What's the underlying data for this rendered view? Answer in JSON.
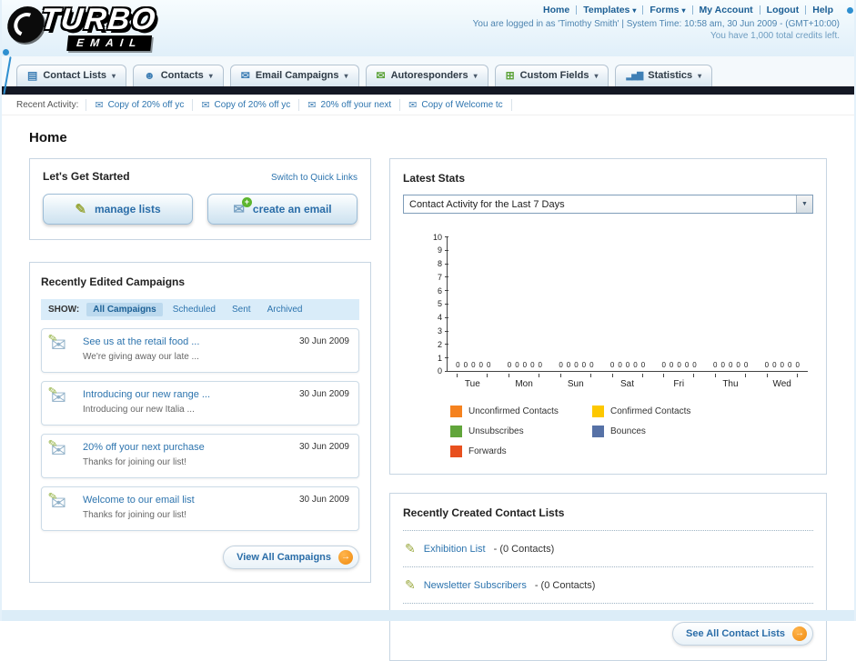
{
  "icons": {
    "chevron_down": "▾",
    "envelope": "✉",
    "pencil": "✎",
    "arrow_right": "→",
    "plus": "+",
    "select_arrow": "▼",
    "contact_lists": "▤",
    "contacts": "☻",
    "custom_fields": "⊞",
    "statistics": "▂▅▇"
  },
  "colors": {
    "accent_orange": "#f6921e",
    "link_blue": "#2d74ae",
    "nav_dark_bar": "#141824",
    "header_blue": "#e0eff9"
  },
  "header": {
    "logo_line1": "TURBO",
    "logo_line2": "EMAIL",
    "links": [
      {
        "label": "Home"
      },
      {
        "label": "Templates"
      },
      {
        "label": "Forms"
      },
      {
        "label": "My Account"
      },
      {
        "label": "Logout"
      },
      {
        "label": "Help"
      }
    ],
    "session_info": "You are logged in as 'Timothy Smith' | System Time: 10:58 am, 30 Jun 2009 - (GMT+10:00)",
    "credits_info": "You have 1,000 total credits left."
  },
  "nav_tabs": [
    {
      "label": "Contact Lists"
    },
    {
      "label": "Contacts"
    },
    {
      "label": "Email Campaigns"
    },
    {
      "label": "Autoresponders"
    },
    {
      "label": "Custom Fields"
    },
    {
      "label": "Statistics"
    }
  ],
  "recent_activity": {
    "label": "Recent Activity:",
    "items": [
      {
        "label": "Copy of 20% off yc"
      },
      {
        "label": "Copy of 20% off yc"
      },
      {
        "label": "20% off your next"
      },
      {
        "label": "Copy of Welcome tc"
      }
    ]
  },
  "page_title": "Home",
  "get_started": {
    "title": "Let's Get Started",
    "switch_link": "Switch to Quick Links",
    "manage_lists_label": "manage lists",
    "create_email_label": "create an email"
  },
  "campaigns": {
    "title": "Recently Edited Campaigns",
    "show_label": "SHOW:",
    "tabs": [
      {
        "label": "All Campaigns"
      },
      {
        "label": "Scheduled"
      },
      {
        "label": "Sent"
      },
      {
        "label": "Archived"
      }
    ],
    "items": [
      {
        "title": "See us at the retail food ...",
        "subtitle": "We're giving away our late ...",
        "date": "30 Jun 2009"
      },
      {
        "title": "Introducing our new range ...",
        "subtitle": "Introducing our new Italia ...",
        "date": "30 Jun 2009"
      },
      {
        "title": "20% off your next purchase",
        "subtitle": "Thanks for joining our list!",
        "date": "30 Jun 2009"
      },
      {
        "title": "Welcome to our email list",
        "subtitle": "Thanks for joining our list!",
        "date": "30 Jun 2009"
      }
    ],
    "view_all_label": "View All Campaigns"
  },
  "stats": {
    "title": "Latest Stats",
    "selected_option": "Contact Activity for the Last 7 Days",
    "chart_data": {
      "type": "bar",
      "title": "Contact Activity for the Last 7 Days",
      "categories": [
        "Tue",
        "Mon",
        "Sun",
        "Sat",
        "Fri",
        "Thu",
        "Wed"
      ],
      "series": [
        {
          "name": "Unconfirmed Contacts",
          "color": "#f5821f",
          "values": [
            0,
            0,
            0,
            0,
            0,
            0,
            0
          ]
        },
        {
          "name": "Confirmed Contacts",
          "color": "#fdc800",
          "values": [
            0,
            0,
            0,
            0,
            0,
            0,
            0
          ]
        },
        {
          "name": "Unsubscribes",
          "color": "#61a53b",
          "values": [
            0,
            0,
            0,
            0,
            0,
            0,
            0
          ]
        },
        {
          "name": "Bounces",
          "color": "#5671a6",
          "values": [
            0,
            0,
            0,
            0,
            0,
            0,
            0
          ]
        },
        {
          "name": "Forwards",
          "color": "#e8501e",
          "values": [
            0,
            0,
            0,
            0,
            0,
            0,
            0
          ]
        }
      ],
      "ylim": [
        0,
        10
      ],
      "ytick_step": 1,
      "grid": false,
      "legend_position": "bottom",
      "value_labels_shown": true
    }
  },
  "contact_lists": {
    "title": "Recently Created Contact Lists",
    "items": [
      {
        "name": "Exhibition List",
        "suffix": "- (0 Contacts)"
      },
      {
        "name": "Newsletter Subscribers",
        "suffix": "- (0 Contacts)"
      }
    ],
    "see_all_label": "See All Contact Lists"
  }
}
